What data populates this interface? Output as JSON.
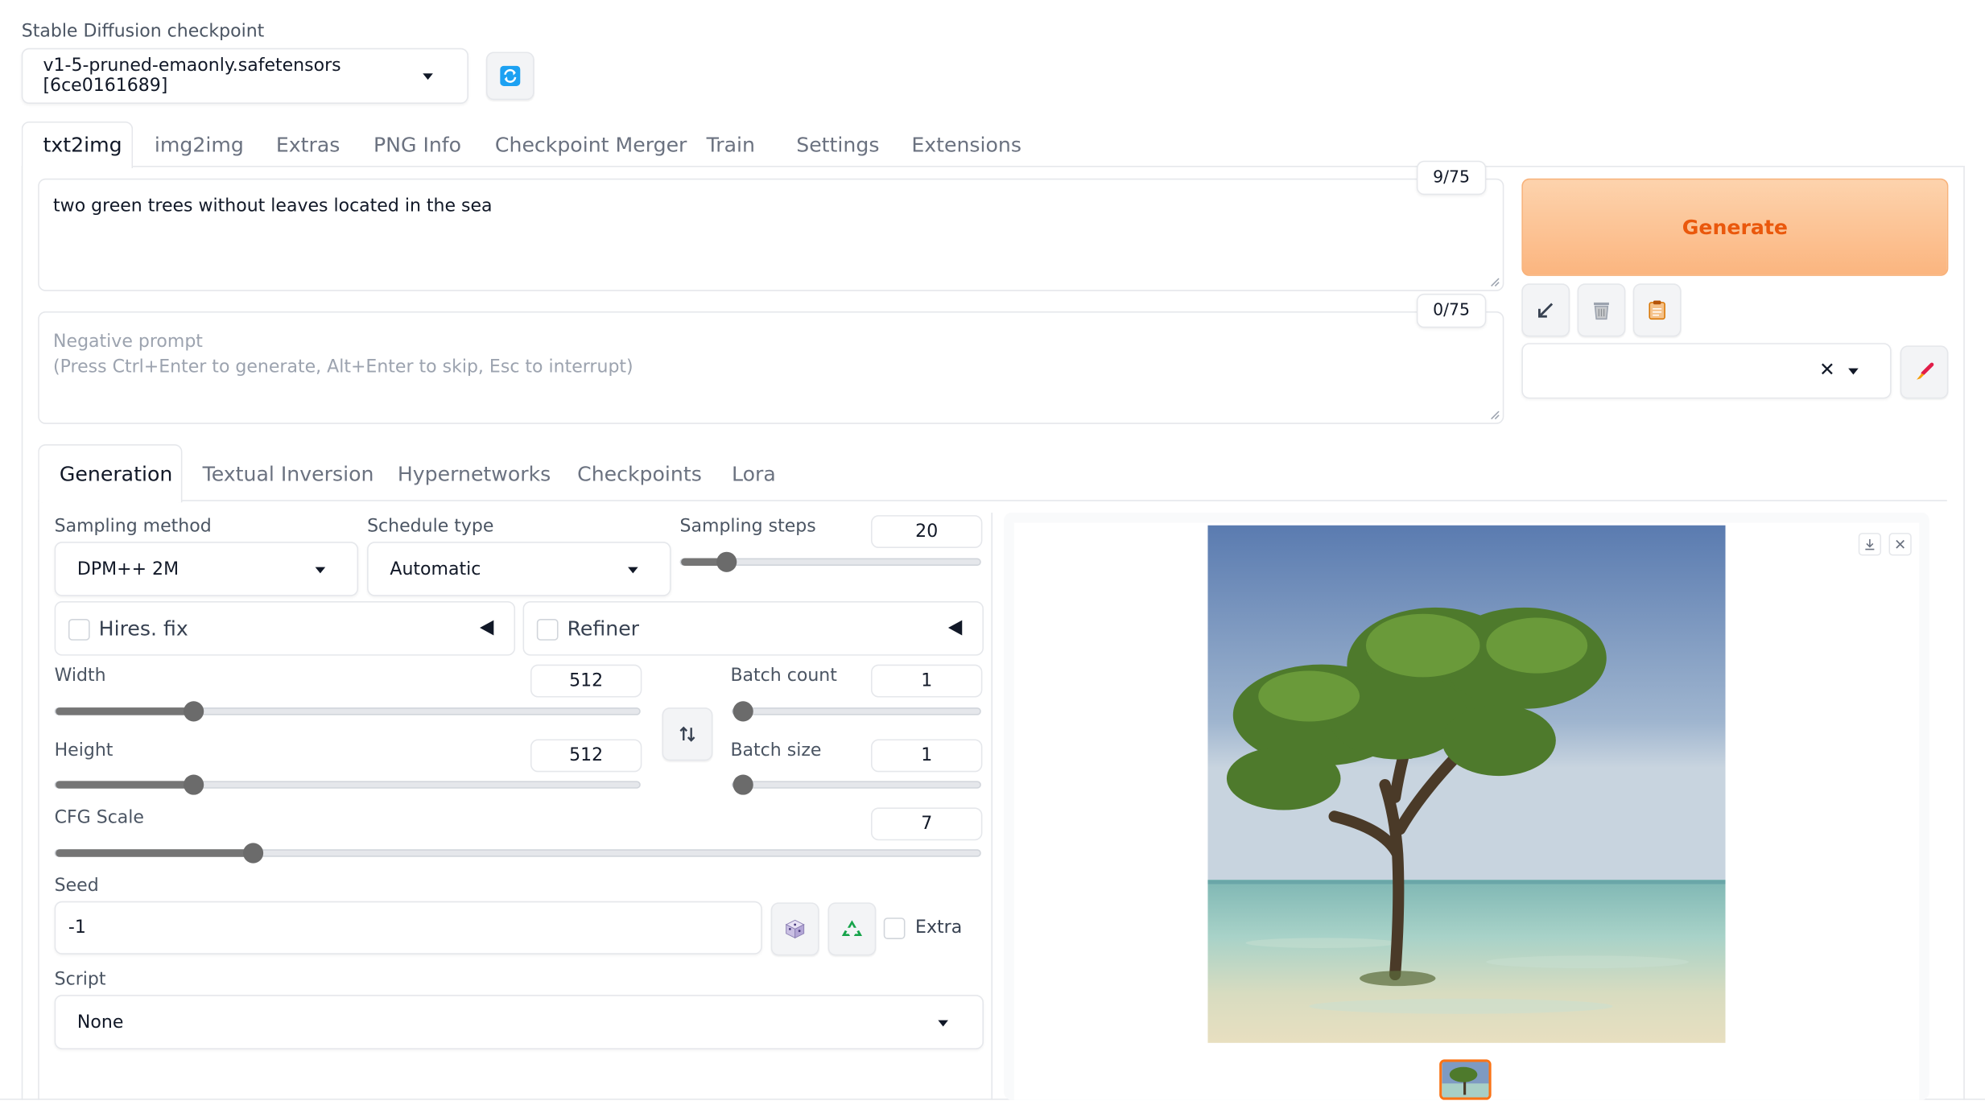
{
  "checkpoint": {
    "label": "Stable Diffusion checkpoint",
    "value": "v1-5-pruned-emaonly.safetensors [6ce0161689]"
  },
  "main_tabs": [
    {
      "label": "txt2img",
      "active": true
    },
    {
      "label": "img2img"
    },
    {
      "label": "Extras"
    },
    {
      "label": "PNG Info"
    },
    {
      "label": "Checkpoint Merger"
    },
    {
      "label": "Train"
    },
    {
      "label": "Settings"
    },
    {
      "label": "Extensions"
    }
  ],
  "prompt": {
    "value": "two green trees without leaves located in the sea",
    "token_count": "9/75"
  },
  "negative_prompt": {
    "placeholder_line1": "Negative prompt",
    "placeholder_line2": "(Press Ctrl+Enter to generate, Alt+Enter to skip, Esc to interrupt)",
    "token_count": "0/75"
  },
  "generate_label": "Generate",
  "styles_clear": "✕",
  "sub_tabs": [
    {
      "label": "Generation",
      "active": true
    },
    {
      "label": "Textual Inversion"
    },
    {
      "label": "Hypernetworks"
    },
    {
      "label": "Checkpoints"
    },
    {
      "label": "Lora"
    }
  ],
  "sampling_method": {
    "label": "Sampling method",
    "value": "DPM++ 2M"
  },
  "schedule_type": {
    "label": "Schedule type",
    "value": "Automatic"
  },
  "sampling_steps": {
    "label": "Sampling steps",
    "value": "20",
    "min": 1,
    "max": 150
  },
  "hires_fix": {
    "label": "Hires. fix",
    "checked": false
  },
  "refiner": {
    "label": "Refiner",
    "checked": false
  },
  "width": {
    "label": "Width",
    "value": "512",
    "min": 64,
    "max": 2048
  },
  "height": {
    "label": "Height",
    "value": "512",
    "min": 64,
    "max": 2048
  },
  "batch_count": {
    "label": "Batch count",
    "value": "1",
    "min": 1,
    "max": 100
  },
  "batch_size": {
    "label": "Batch size",
    "value": "1",
    "min": 1,
    "max": 8
  },
  "cfg_scale": {
    "label": "CFG Scale",
    "value": "7",
    "min": 1,
    "max": 30
  },
  "seed": {
    "label": "Seed",
    "value": "-1",
    "extra_label": "Extra"
  },
  "script": {
    "label": "Script",
    "value": "None"
  },
  "colors": {
    "generate_start": "#fdd3ad",
    "generate_end": "#fba96a",
    "generate_text": "#ea580c",
    "slider": "#757575"
  }
}
